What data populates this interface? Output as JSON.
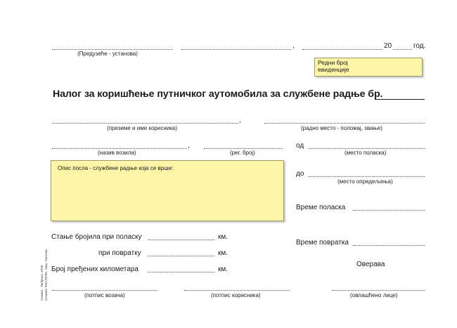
{
  "header": {
    "year_prefix": "20",
    "year_suffix": "год.",
    "company_caption": "(Предузеће - установа)",
    "registry_label": "Редни број евиденције"
  },
  "title": "Налог за коришћење путничког аутомобила за службене радње бр.",
  "fields": {
    "user_name_caption": "(презиме и име корисника)",
    "job_caption": "(радно место - положај, звање)",
    "vehicle_caption": "(назив возила)",
    "reg_caption": "(рег. број)",
    "from_label": "од",
    "from_caption": "(место поласка)",
    "to_label": "до",
    "to_caption": "(место   опредељења)",
    "job_desc_label": "Опис посла - службене радње која се врши:",
    "departure_label": "Време поласка",
    "return_label": "Време повратка",
    "verify_label": "Оверава"
  },
  "odometer": {
    "start_label": "Стање бројила при поласку",
    "return_label": "при повратку",
    "total_label": "Број пређених километара",
    "unit": "км."
  },
  "signatures": {
    "driver": "(потпис возача)",
    "user": "(потпис корисника)",
    "authorized": "(овлашћено лице)"
  },
  "side_print": [
    "Ознака - Увођење: 4938",
    "Штампа: ФЕСТЕЋЕ, Ниш, Панчево"
  ]
}
